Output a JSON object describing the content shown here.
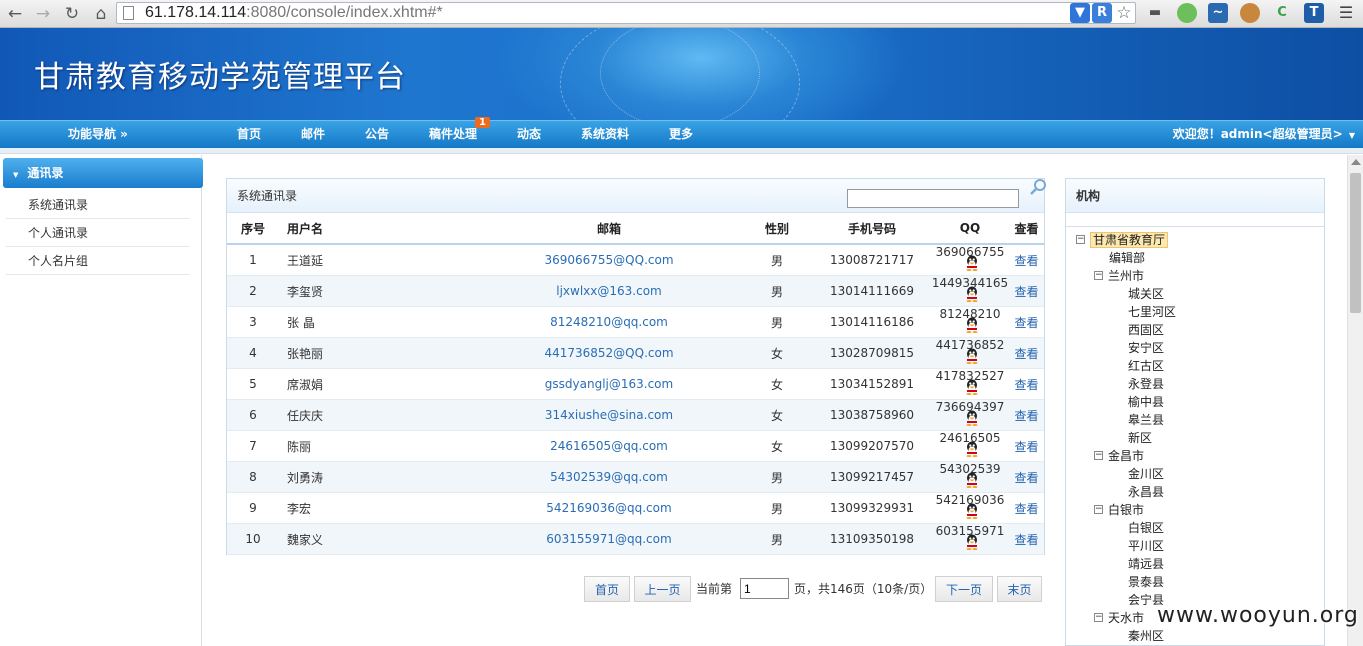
{
  "browser": {
    "url_host": "61.178.14.114",
    "url_rest": ":8080/console/index.xhtm#*"
  },
  "header": {
    "title": "甘肃教育移动学苑管理平台"
  },
  "nav": {
    "func_nav": "功能导航 »",
    "items": [
      "首页",
      "邮件",
      "公告",
      "稿件处理",
      "动态",
      "系统资料",
      "更多"
    ],
    "badge": "1",
    "welcome": "欢迎您！admin<超级管理员>"
  },
  "sidebar": {
    "heading": "通讯录",
    "items": [
      "系统通讯录",
      "个人通讯录",
      "个人名片组"
    ]
  },
  "main": {
    "title": "系统通讯录",
    "search_value": "",
    "columns": [
      "序号",
      "用户名",
      "邮箱",
      "性别",
      "手机号码",
      "QQ",
      "查看"
    ],
    "rows": [
      {
        "no": "1",
        "name": "王道延",
        "email": "369066755@QQ.com",
        "gender": "男",
        "phone": "13008721717",
        "qq": "369066755",
        "view": "查看"
      },
      {
        "no": "2",
        "name": "李玺贤",
        "email": "ljxwlxx@163.com",
        "gender": "男",
        "phone": "13014111669",
        "qq": "1449344165",
        "view": "查看"
      },
      {
        "no": "3",
        "name": "张 晶",
        "email": "81248210@qq.com",
        "gender": "男",
        "phone": "13014116186",
        "qq": "81248210",
        "view": "查看"
      },
      {
        "no": "4",
        "name": "张艳丽",
        "email": "441736852@QQ.com",
        "gender": "女",
        "phone": "13028709815",
        "qq": "441736852",
        "view": "查看"
      },
      {
        "no": "5",
        "name": "席淑娟",
        "email": "gssdyanglj@163.com",
        "gender": "女",
        "phone": "13034152891",
        "qq": "417832527",
        "view": "查看"
      },
      {
        "no": "6",
        "name": "任庆庆",
        "email": "314xiushe@sina.com",
        "gender": "女",
        "phone": "13038758960",
        "qq": "736694397",
        "view": "查看"
      },
      {
        "no": "7",
        "name": "陈丽",
        "email": "24616505@qq.com",
        "gender": "女",
        "phone": "13099207570",
        "qq": "24616505",
        "view": "查看"
      },
      {
        "no": "8",
        "name": "刘勇涛",
        "email": "54302539@qq.com",
        "gender": "男",
        "phone": "13099217457",
        "qq": "54302539",
        "view": "查看"
      },
      {
        "no": "9",
        "name": "李宏",
        "email": "542169036@qq.com",
        "gender": "男",
        "phone": "13099329931",
        "qq": "542169036",
        "view": "查看"
      },
      {
        "no": "10",
        "name": "魏家义",
        "email": "603155971@qq.com",
        "gender": "男",
        "phone": "13109350198",
        "qq": "603155971",
        "view": "查看"
      }
    ]
  },
  "pager": {
    "first": "首页",
    "prev": "上一页",
    "current_label": "当前第",
    "current_page": "1",
    "summary": "页，共146页（10条/页）",
    "next": "下一页",
    "last": "末页"
  },
  "org": {
    "title": "机构",
    "tree": [
      {
        "label": "甘肃省教育厅",
        "level": 0,
        "toggle": "−",
        "selected": true
      },
      {
        "label": "编辑部",
        "level": 1,
        "toggle": ""
      },
      {
        "label": "兰州市",
        "level": 1,
        "toggle": "−"
      },
      {
        "label": "城关区",
        "level": 2,
        "toggle": ""
      },
      {
        "label": "七里河区",
        "level": 2,
        "toggle": ""
      },
      {
        "label": "西固区",
        "level": 2,
        "toggle": ""
      },
      {
        "label": "安宁区",
        "level": 2,
        "toggle": ""
      },
      {
        "label": "红古区",
        "level": 2,
        "toggle": ""
      },
      {
        "label": "永登县",
        "level": 2,
        "toggle": ""
      },
      {
        "label": "榆中县",
        "level": 2,
        "toggle": ""
      },
      {
        "label": "皋兰县",
        "level": 2,
        "toggle": ""
      },
      {
        "label": "新区",
        "level": 2,
        "toggle": ""
      },
      {
        "label": "金昌市",
        "level": 1,
        "toggle": "−"
      },
      {
        "label": "金川区",
        "level": 2,
        "toggle": ""
      },
      {
        "label": "永昌县",
        "level": 2,
        "toggle": ""
      },
      {
        "label": "白银市",
        "level": 1,
        "toggle": "−"
      },
      {
        "label": "白银区",
        "level": 2,
        "toggle": ""
      },
      {
        "label": "平川区",
        "level": 2,
        "toggle": ""
      },
      {
        "label": "靖远县",
        "level": 2,
        "toggle": ""
      },
      {
        "label": "景泰县",
        "level": 2,
        "toggle": ""
      },
      {
        "label": "会宁县",
        "level": 2,
        "toggle": ""
      },
      {
        "label": "天水市",
        "level": 1,
        "toggle": "−"
      },
      {
        "label": "秦州区",
        "level": 2,
        "toggle": ""
      }
    ]
  },
  "watermark": "www.wooyun.org",
  "colors": {
    "banner": "#1b6fc9",
    "nav": "#1478c7",
    "link": "#2363b0"
  }
}
